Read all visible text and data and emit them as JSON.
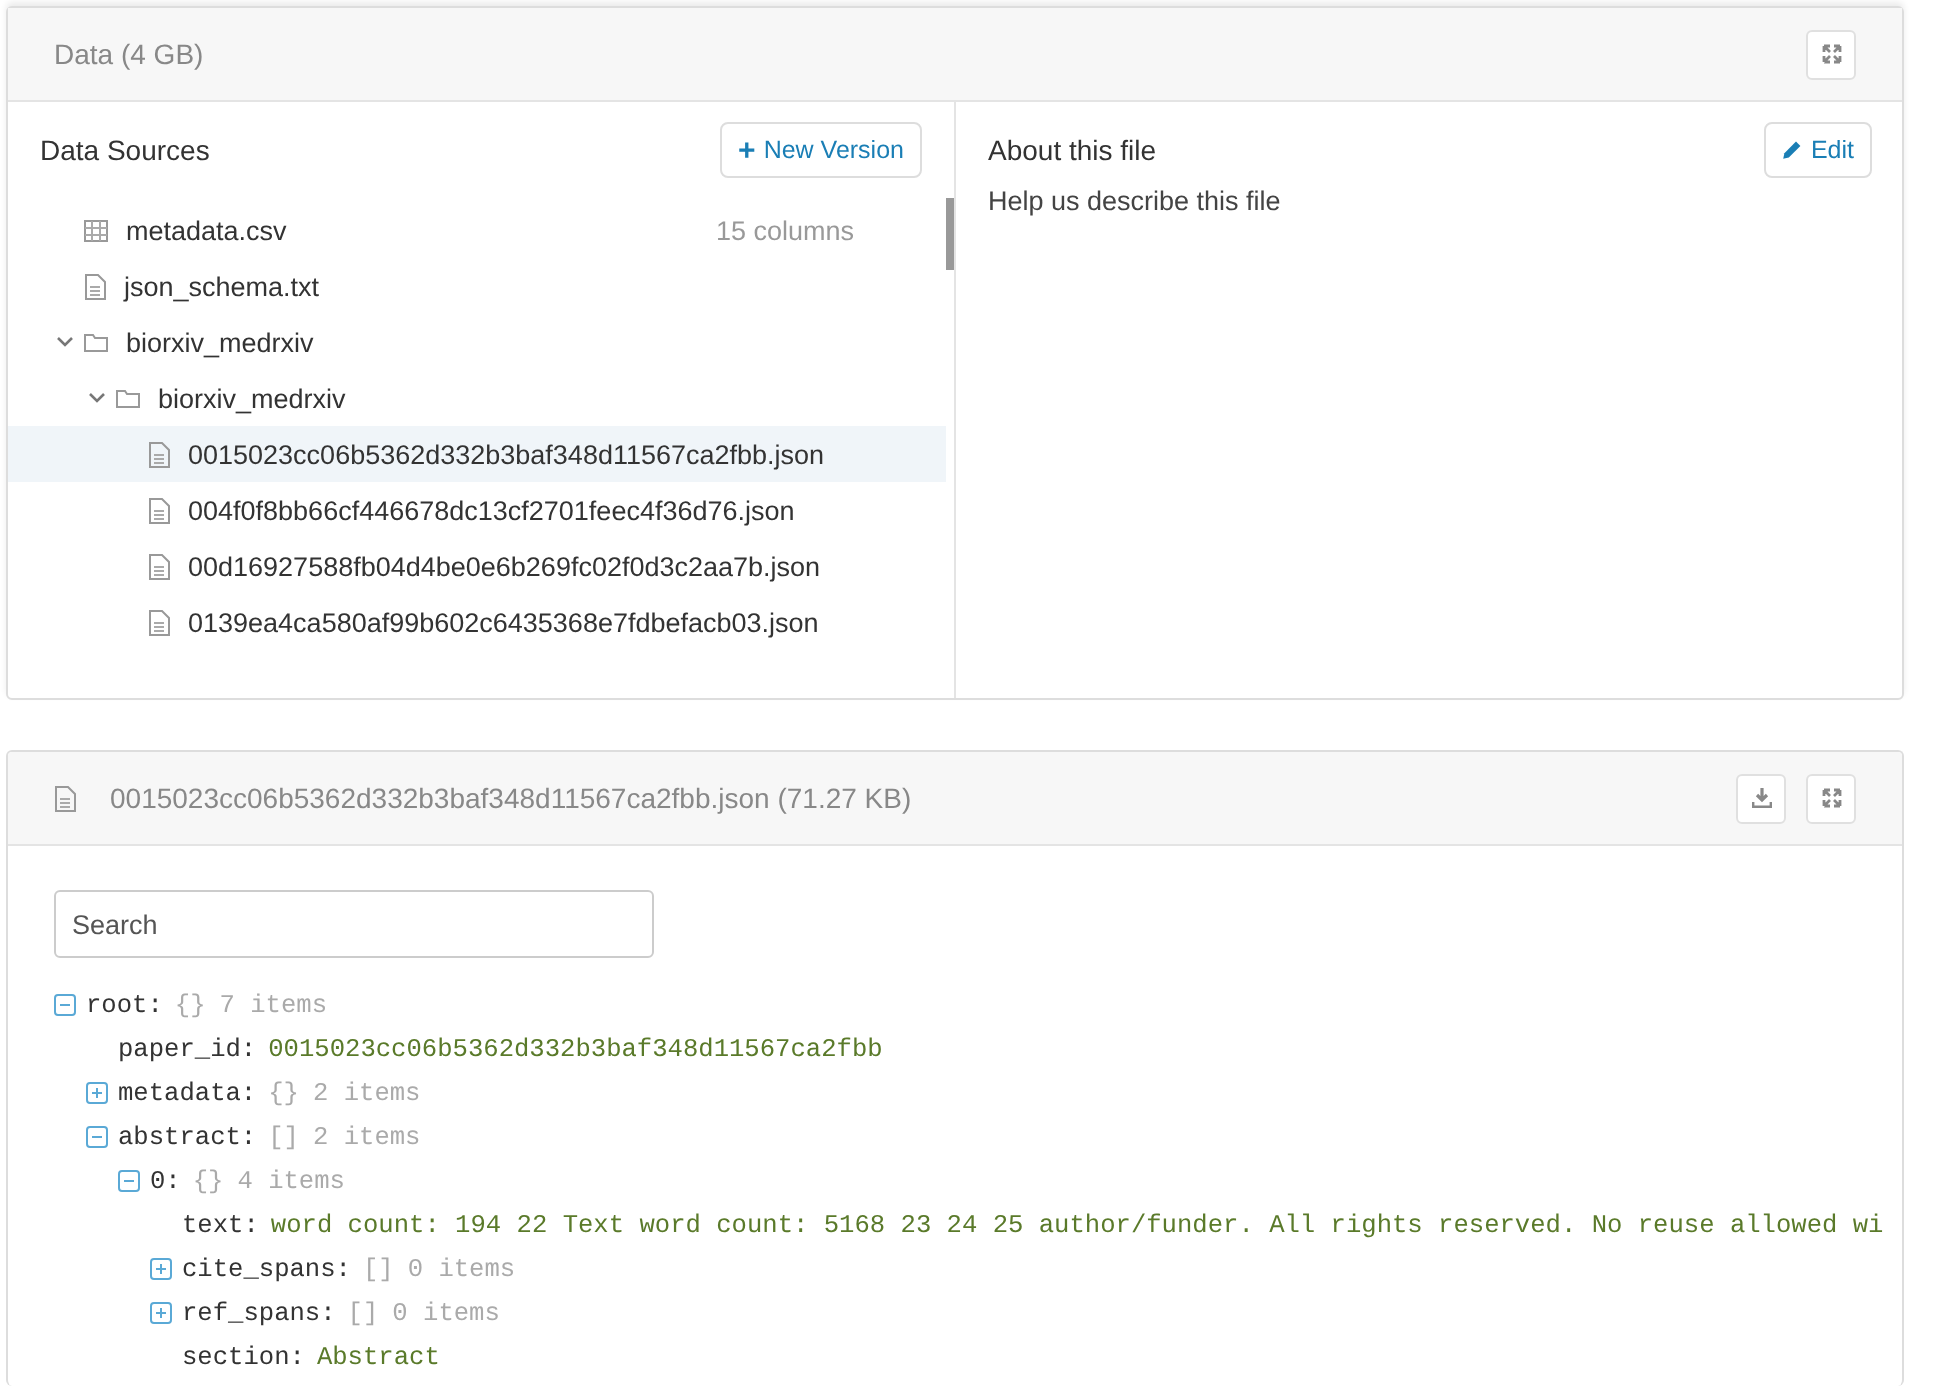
{
  "data_panel": {
    "title": "Data (4 GB)",
    "sources": {
      "title": "Data Sources",
      "new_version_button": {
        "icon": "+",
        "label": "New Version"
      },
      "tree": [
        {
          "kind": "table",
          "name": "metadata.csv",
          "meta": "15 columns",
          "selected": false
        },
        {
          "kind": "file",
          "name": "json_schema.txt",
          "selected": false
        },
        {
          "kind": "folder",
          "name": "biorxiv_medrxiv",
          "expanded": true,
          "selected": false,
          "children": [
            {
              "kind": "folder",
              "name": "biorxiv_medrxiv",
              "expanded": true,
              "selected": false,
              "children": [
                {
                  "kind": "file",
                  "name": "0015023cc06b5362d332b3baf348d11567ca2fbb.json",
                  "selected": true
                },
                {
                  "kind": "file",
                  "name": "004f0f8bb66cf446678dc13cf2701feec4f36d76.json",
                  "selected": false
                },
                {
                  "kind": "file",
                  "name": "00d16927588fb04d4be0e6b269fc02f0d3c2aa7b.json",
                  "selected": false
                },
                {
                  "kind": "file",
                  "name": "0139ea4ca580af99b602c6435368e7fdbefacb03.json",
                  "selected": false
                }
              ]
            }
          ]
        }
      ]
    },
    "about": {
      "title": "About this file",
      "edit_button": "Edit",
      "description": "Help us describe this file"
    }
  },
  "file_panel": {
    "title": "0015023cc06b5362d332b3baf348d11567ca2fbb.json (71.27 KB)",
    "search": {
      "placeholder": "Search"
    },
    "tree": [
      {
        "kind": "container",
        "key": "root:",
        "brackets": "{}",
        "count": "7 items",
        "expanded": true,
        "children": [
          {
            "kind": "value",
            "key": "paper_id:",
            "value": "0015023cc06b5362d332b3baf348d11567ca2fbb"
          },
          {
            "kind": "container",
            "key": "metadata:",
            "brackets": "{}",
            "count": "2 items",
            "expanded": false
          },
          {
            "kind": "container",
            "key": "abstract:",
            "brackets": "[]",
            "count": "2 items",
            "expanded": true,
            "children": [
              {
                "kind": "container",
                "key": "0:",
                "brackets": "{}",
                "count": "4 items",
                "expanded": true,
                "children": [
                  {
                    "kind": "value",
                    "key": "text:",
                    "value": "word count: 194 22 Text word count: 5168 23 24 25 author/funder. All rights reserved. No reuse allowed wi"
                  },
                  {
                    "kind": "container",
                    "key": "cite_spans:",
                    "brackets": "[]",
                    "count": "0 items",
                    "expanded": false
                  },
                  {
                    "kind": "container",
                    "key": "ref_spans:",
                    "brackets": "[]",
                    "count": "0 items",
                    "expanded": false
                  },
                  {
                    "kind": "value",
                    "key": "section:",
                    "value": "Abstract"
                  }
                ]
              }
            ]
          }
        ]
      }
    ]
  }
}
